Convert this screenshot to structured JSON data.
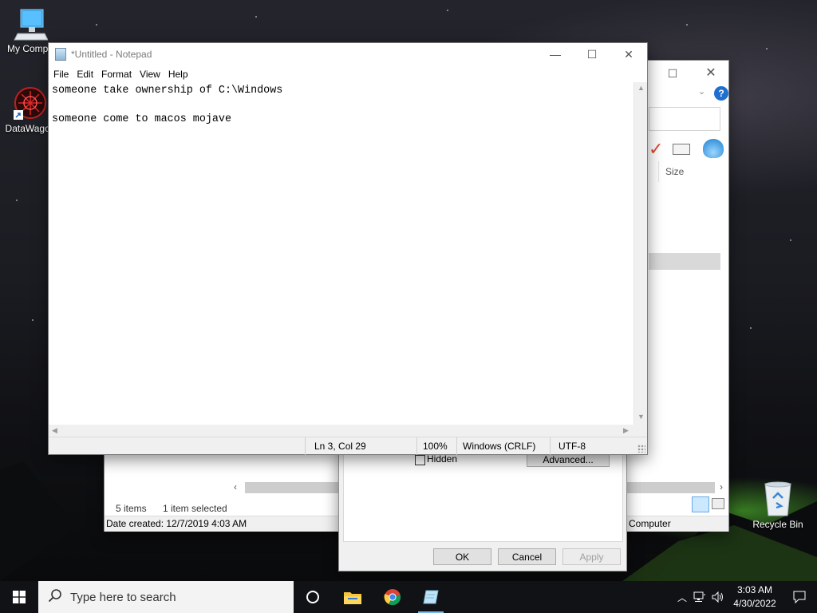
{
  "desktop": {
    "icons": [
      {
        "label": "My Compu",
        "icon": "computer-icon"
      },
      {
        "label": "DataWagon",
        "icon": "datawagon-icon"
      },
      {
        "label": "Recycle Bin",
        "icon": "recycle-bin-icon"
      }
    ]
  },
  "notepad": {
    "title": "*Untitled - Notepad",
    "menu": [
      "File",
      "Edit",
      "Format",
      "View",
      "Help"
    ],
    "lines": [
      "someone take ownership of C:\\Windows",
      "",
      "someone come to macos mojave"
    ],
    "status": {
      "position": "Ln 3, Col 29",
      "zoom": "100%",
      "line_ending": "Windows (CRLF)",
      "encoding": "UTF-8"
    }
  },
  "explorer": {
    "column_size": "Size",
    "items_count": "5 items",
    "selected": "1 item selected",
    "date_created": "Date created: 12/7/2019 4:03 AM",
    "computer_label": "Computer"
  },
  "properties": {
    "hidden_label": "Hidden",
    "advanced": "Advanced...",
    "ok": "OK",
    "cancel": "Cancel",
    "apply": "Apply"
  },
  "taskbar": {
    "search_placeholder": "Type here to search",
    "time": "3:03 AM",
    "date": "4/30/2022"
  },
  "colors": {
    "accent": "#0078d7",
    "taskbar": "#101216",
    "selection": "#cce8ff"
  }
}
